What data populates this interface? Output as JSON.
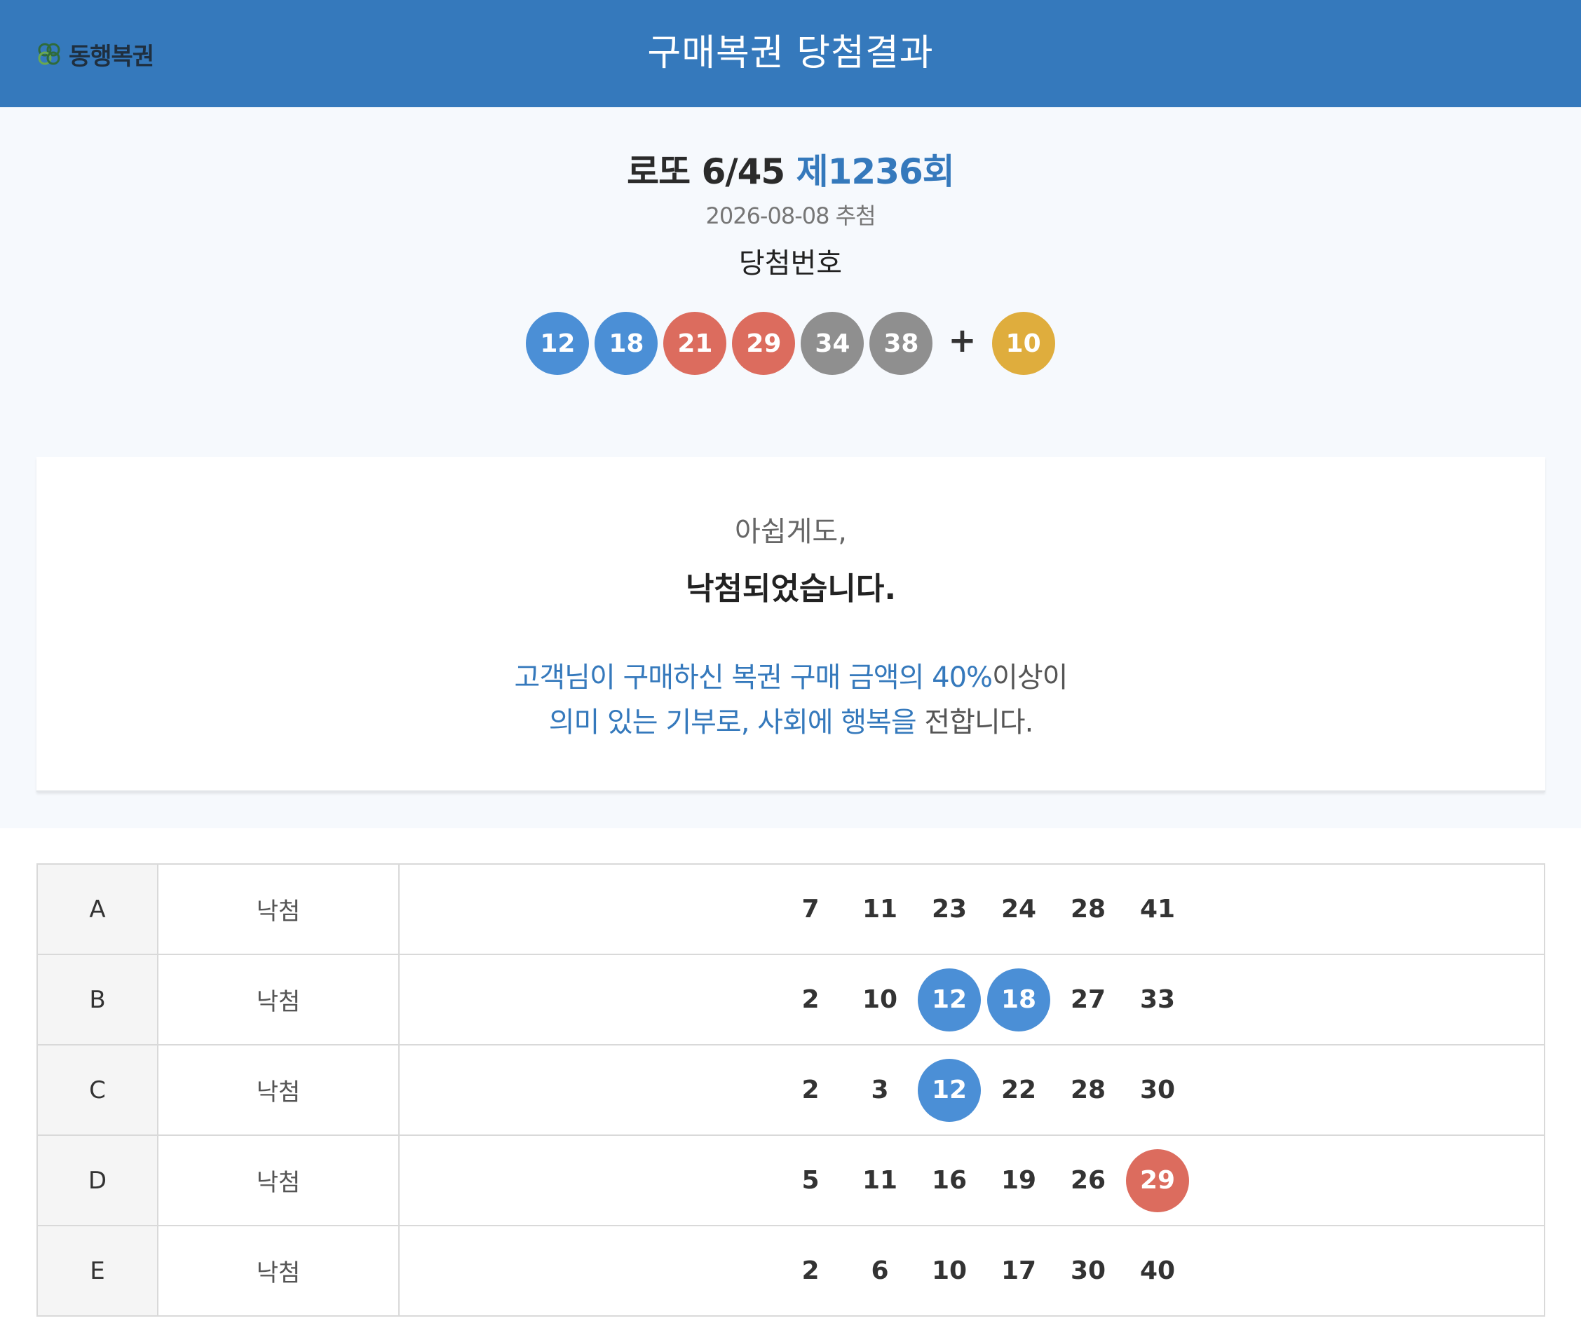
{
  "header": {
    "logo_text": "동행복권",
    "title": "구매복권 당첨결과"
  },
  "draw": {
    "game_name": "로또 6/45",
    "round": "제1236회",
    "date": "2026-08-08 추첨",
    "winning_label": "당첨번호",
    "numbers": [
      {
        "value": "12",
        "color": "blue"
      },
      {
        "value": "18",
        "color": "blue"
      },
      {
        "value": "21",
        "color": "red"
      },
      {
        "value": "29",
        "color": "red"
      },
      {
        "value": "34",
        "color": "gray"
      },
      {
        "value": "38",
        "color": "gray"
      }
    ],
    "plus": "+",
    "bonus": {
      "value": "10",
      "color": "yellow"
    }
  },
  "result": {
    "sub": "아쉽게도,",
    "main": "낙첨되었습니다.",
    "msg_line1_blue": "고객님이 구매하신 복권 구매 금액의 40%",
    "msg_line1_plain": "이상이",
    "msg_line2_blue": "의미 있는 기부로, 사회에 행복을",
    "msg_line2_plain": " 전합니다."
  },
  "tickets": [
    {
      "game": "A",
      "result": "낙첨",
      "numbers": [
        {
          "v": "7",
          "hit": ""
        },
        {
          "v": "11",
          "hit": ""
        },
        {
          "v": "23",
          "hit": ""
        },
        {
          "v": "24",
          "hit": ""
        },
        {
          "v": "28",
          "hit": ""
        },
        {
          "v": "41",
          "hit": ""
        }
      ]
    },
    {
      "game": "B",
      "result": "낙첨",
      "numbers": [
        {
          "v": "2",
          "hit": ""
        },
        {
          "v": "10",
          "hit": ""
        },
        {
          "v": "12",
          "hit": "blue"
        },
        {
          "v": "18",
          "hit": "blue"
        },
        {
          "v": "27",
          "hit": ""
        },
        {
          "v": "33",
          "hit": ""
        }
      ]
    },
    {
      "game": "C",
      "result": "낙첨",
      "numbers": [
        {
          "v": "2",
          "hit": ""
        },
        {
          "v": "3",
          "hit": ""
        },
        {
          "v": "12",
          "hit": "blue"
        },
        {
          "v": "22",
          "hit": ""
        },
        {
          "v": "28",
          "hit": ""
        },
        {
          "v": "30",
          "hit": ""
        }
      ]
    },
    {
      "game": "D",
      "result": "낙첨",
      "numbers": [
        {
          "v": "5",
          "hit": ""
        },
        {
          "v": "11",
          "hit": ""
        },
        {
          "v": "16",
          "hit": ""
        },
        {
          "v": "19",
          "hit": ""
        },
        {
          "v": "26",
          "hit": ""
        },
        {
          "v": "29",
          "hit": "red"
        }
      ]
    },
    {
      "game": "E",
      "result": "낙첨",
      "numbers": [
        {
          "v": "2",
          "hit": ""
        },
        {
          "v": "6",
          "hit": ""
        },
        {
          "v": "10",
          "hit": ""
        },
        {
          "v": "17",
          "hit": ""
        },
        {
          "v": "30",
          "hit": ""
        },
        {
          "v": "40",
          "hit": ""
        }
      ]
    }
  ],
  "colors": {
    "header_bg": "#3579bc",
    "accent": "#3579bc",
    "ball_blue": "#4b8fd6",
    "ball_red": "#dc6c5e",
    "ball_gray": "#8f8f8f",
    "ball_yellow": "#dfad3d"
  }
}
